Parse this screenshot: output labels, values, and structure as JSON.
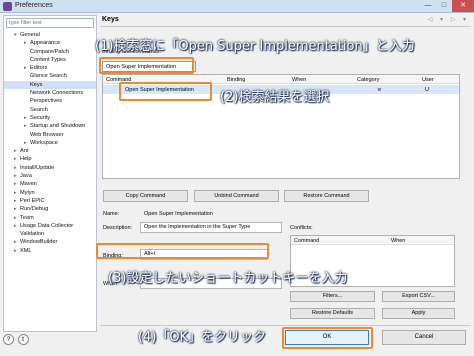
{
  "window": {
    "title": "Preferences",
    "minimize": "—",
    "maximize": "□",
    "close": "✕"
  },
  "sidebar": {
    "filter_placeholder": "type filter text",
    "items": [
      {
        "label": "General",
        "level": 1,
        "toggle": "▾"
      },
      {
        "label": "Appearance",
        "level": 2,
        "toggle": "▸"
      },
      {
        "label": "Compare/Patch",
        "level": 2,
        "toggle": ""
      },
      {
        "label": "Content Types",
        "level": 2,
        "toggle": ""
      },
      {
        "label": "Editors",
        "level": 2,
        "toggle": "▸"
      },
      {
        "label": "Glance Search",
        "level": 2,
        "toggle": ""
      },
      {
        "label": "Keys",
        "level": 2,
        "toggle": "",
        "selected": true
      },
      {
        "label": "Network Connections",
        "level": 2,
        "toggle": ""
      },
      {
        "label": "Perspectives",
        "level": 2,
        "toggle": ""
      },
      {
        "label": "Search",
        "level": 2,
        "toggle": ""
      },
      {
        "label": "Security",
        "level": 2,
        "toggle": "▸"
      },
      {
        "label": "Startup and Shutdown",
        "level": 2,
        "toggle": "▸"
      },
      {
        "label": "Web Browser",
        "level": 2,
        "toggle": ""
      },
      {
        "label": "Workspace",
        "level": 2,
        "toggle": "▸"
      },
      {
        "label": "Ant",
        "level": 1,
        "toggle": "▸"
      },
      {
        "label": "Help",
        "level": 1,
        "toggle": "▸"
      },
      {
        "label": "Install/Update",
        "level": 1,
        "toggle": "▸"
      },
      {
        "label": "Java",
        "level": 1,
        "toggle": "▸"
      },
      {
        "label": "Maven",
        "level": 1,
        "toggle": "▸"
      },
      {
        "label": "Mylyn",
        "level": 1,
        "toggle": "▸"
      },
      {
        "label": "Perl EPIC",
        "level": 1,
        "toggle": "▸"
      },
      {
        "label": "Run/Debug",
        "level": 1,
        "toggle": "▸"
      },
      {
        "label": "Team",
        "level": 1,
        "toggle": "▸"
      },
      {
        "label": "Usage Data Collector",
        "level": 1,
        "toggle": "▸"
      },
      {
        "label": "Validation",
        "level": 1,
        "toggle": ""
      },
      {
        "label": "WindowBuilder",
        "level": 1,
        "toggle": "▸"
      },
      {
        "label": "XML",
        "level": 1,
        "toggle": "▸"
      }
    ],
    "help_icon": "?",
    "import_icon": "⇪"
  },
  "main": {
    "title": "Keys",
    "nav_arrows": "◁ ▾ ▷ ▾",
    "description": "Binding and commands:",
    "search_value": "Open Super Implementation",
    "table": {
      "columns": [
        "Command",
        "Binding",
        "When",
        "Category",
        "User"
      ],
      "rows": [
        {
          "command": "Open Super Implementation",
          "binding": "",
          "when": "",
          "category": "e",
          "user": "U"
        }
      ]
    },
    "buttons": {
      "copy": "Copy Command",
      "unbind": "Unbind Command",
      "restore": "Restore Command"
    },
    "details": {
      "name_label": "Name:",
      "name_value": "Open Super Implementation",
      "description_label": "Description:",
      "description_value": "Open the Implementation in the Super Type",
      "binding_label": "Binding:",
      "binding_value": "Alt+I",
      "when_label": "When:"
    },
    "conflicts": {
      "label": "Conflicts:",
      "columns": [
        "Command",
        "When"
      ]
    },
    "side_buttons": {
      "filters": "Filters...",
      "export": "Export CSV...",
      "restore_defaults": "Restore Defaults",
      "apply": "Apply"
    }
  },
  "footer": {
    "ok": "OK",
    "cancel": "Cancel"
  },
  "annotations": {
    "step1": "(1)検索窓に「Open Super Implementation」と入力",
    "step2": "(2)検索結果を選択",
    "step3": "(3)設定したいショートカットキーを入力",
    "step4": "(4)「OK」をクリック",
    "accent_color": "#ef8a2a"
  }
}
